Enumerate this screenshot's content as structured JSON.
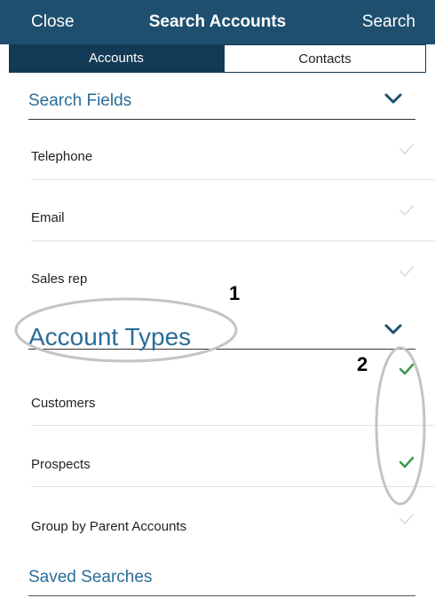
{
  "navbar": {
    "close_label": "Close",
    "title": "Search Accounts",
    "search_label": "Search",
    "background": "#1e4f6f"
  },
  "segments": {
    "items": [
      {
        "label": "Accounts",
        "selected": true
      },
      {
        "label": "Contacts",
        "selected": false
      }
    ]
  },
  "sections": {
    "search_fields": {
      "title": "Search Fields",
      "expanded": true,
      "rows": [
        {
          "label": "Telephone",
          "checked": false
        },
        {
          "label": "Email",
          "checked": false
        },
        {
          "label": "Sales rep",
          "checked": false
        }
      ]
    },
    "account_types": {
      "title": "Account Types",
      "expanded": true,
      "rows": [
        {
          "label": "Customers",
          "checked": true
        },
        {
          "label": "Prospects",
          "checked": true
        },
        {
          "label": "Group by Parent Accounts",
          "checked": false
        }
      ]
    },
    "saved_searches": {
      "title": "Saved Searches"
    }
  },
  "annotations": {
    "marker_1": "1",
    "marker_2": "2"
  },
  "colors": {
    "accent": "#2a6d99",
    "check_on": "#3a9a4a",
    "check_off": "#d0d0d0"
  },
  "icons": {
    "chevron": "chevron-down-icon",
    "check": "checkmark-icon"
  }
}
